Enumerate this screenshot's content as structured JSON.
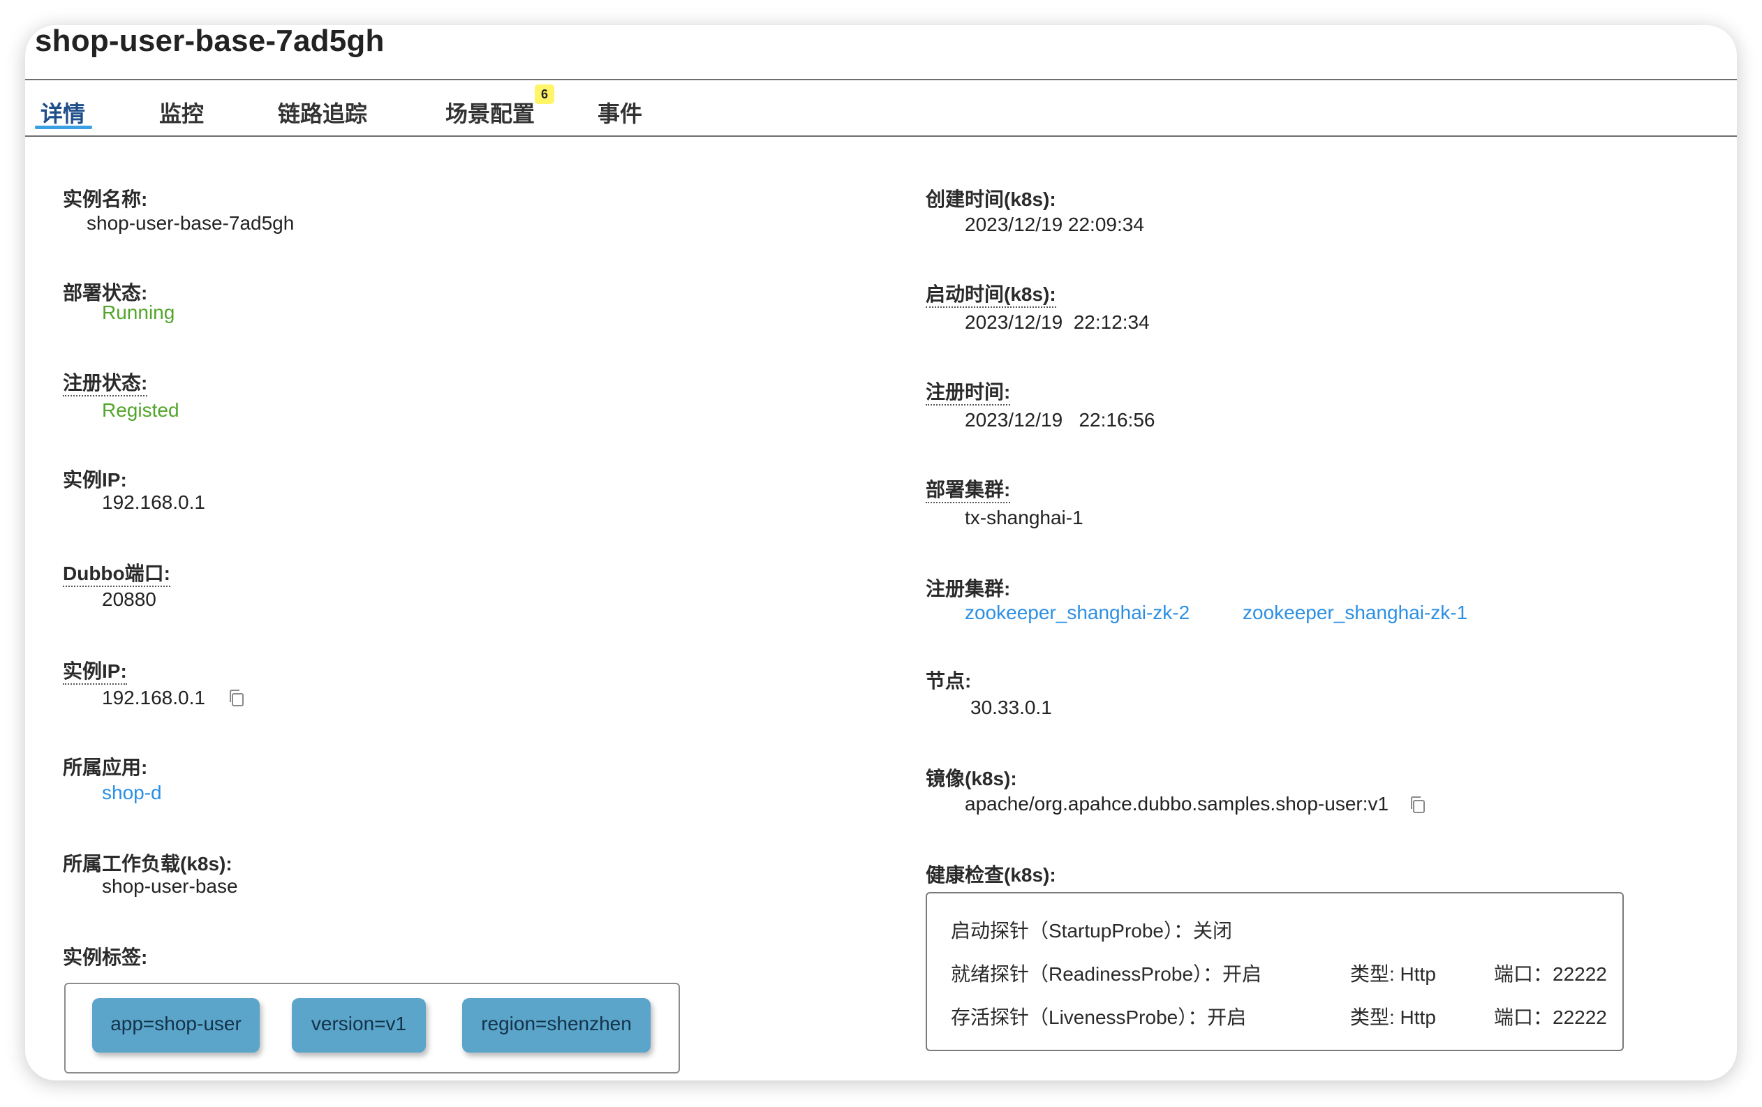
{
  "title": "shop-user-base-7ad5gh",
  "tabs": [
    {
      "label": "详情"
    },
    {
      "label": "监控"
    },
    {
      "label": "链路追踪"
    },
    {
      "label": "场景配置",
      "badge": "6"
    },
    {
      "label": "事件"
    }
  ],
  "left": {
    "instance_name": {
      "label": "实例名称:",
      "value": "shop-user-base-7ad5gh"
    },
    "deploy_status": {
      "label": "部署状态:",
      "value": "Running"
    },
    "register_status": {
      "label": "注册状态:",
      "value": "Registed"
    },
    "instance_ip": {
      "label": "实例IP:",
      "value": "192.168.0.1"
    },
    "dubbo_port": {
      "label": "Dubbo端口:",
      "value": "20880"
    },
    "instance_ip2": {
      "label": "实例IP:",
      "value": "192.168.0.1"
    },
    "app": {
      "label": "所属应用:",
      "value": "shop-d"
    },
    "workload": {
      "label": "所属工作负载(k8s):",
      "value": "shop-user-base"
    },
    "tags_label": "实例标签:",
    "tags": [
      "app=shop-user",
      "version=v1",
      "region=shenzhen"
    ]
  },
  "right": {
    "create_time": {
      "label": "创建时间(k8s):",
      "value": "2023/12/19 22:09:34"
    },
    "start_time": {
      "label": "启动时间(k8s):",
      "value": "2023/12/19  22:12:34"
    },
    "register_time": {
      "label": "注册时间:",
      "value": "2023/12/19   22:16:56"
    },
    "deploy_cluster": {
      "label": "部署集群:",
      "value": "tx-shanghai-1"
    },
    "register_cluster": {
      "label": "注册集群:",
      "values": [
        "zookeeper_shanghai-zk-2",
        "zookeeper_shanghai-zk-1"
      ]
    },
    "node": {
      "label": "节点:",
      "value": "30.33.0.1"
    },
    "image": {
      "label": "镜像(k8s):",
      "value": "apache/org.apahce.dubbo.samples.shop-user:v1"
    },
    "health": {
      "label": "健康检查(k8s):",
      "startup": "启动探针（StartupProbe）：关闭",
      "readiness": "就绪探针（ReadinessProbe）：开启",
      "readiness_type": "类型: Http",
      "readiness_port": "端口：22222",
      "liveness": "存活探针（LivenessProbe）：开启",
      "liveness_type": "类型: Http",
      "liveness_port": "端口：22222"
    }
  },
  "icons": {
    "copy": "copy-icon"
  },
  "colors": {
    "accent": "#3aa0e4",
    "status_green": "#52a52a",
    "link": "#2c8fe3",
    "tag_bg": "#5aa5c9",
    "badge": "#fff566"
  }
}
